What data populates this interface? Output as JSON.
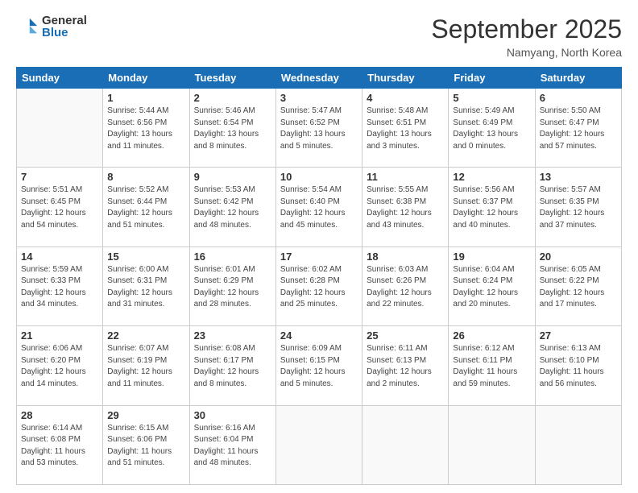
{
  "logo": {
    "general": "General",
    "blue": "Blue"
  },
  "header": {
    "month": "September 2025",
    "location": "Namyang, North Korea"
  },
  "days": [
    "Sunday",
    "Monday",
    "Tuesday",
    "Wednesday",
    "Thursday",
    "Friday",
    "Saturday"
  ],
  "weeks": [
    [
      {
        "day": "",
        "info": ""
      },
      {
        "day": "1",
        "info": "Sunrise: 5:44 AM\nSunset: 6:56 PM\nDaylight: 13 hours\nand 11 minutes."
      },
      {
        "day": "2",
        "info": "Sunrise: 5:46 AM\nSunset: 6:54 PM\nDaylight: 13 hours\nand 8 minutes."
      },
      {
        "day": "3",
        "info": "Sunrise: 5:47 AM\nSunset: 6:52 PM\nDaylight: 13 hours\nand 5 minutes."
      },
      {
        "day": "4",
        "info": "Sunrise: 5:48 AM\nSunset: 6:51 PM\nDaylight: 13 hours\nand 3 minutes."
      },
      {
        "day": "5",
        "info": "Sunrise: 5:49 AM\nSunset: 6:49 PM\nDaylight: 13 hours\nand 0 minutes."
      },
      {
        "day": "6",
        "info": "Sunrise: 5:50 AM\nSunset: 6:47 PM\nDaylight: 12 hours\nand 57 minutes."
      }
    ],
    [
      {
        "day": "7",
        "info": "Sunrise: 5:51 AM\nSunset: 6:45 PM\nDaylight: 12 hours\nand 54 minutes."
      },
      {
        "day": "8",
        "info": "Sunrise: 5:52 AM\nSunset: 6:44 PM\nDaylight: 12 hours\nand 51 minutes."
      },
      {
        "day": "9",
        "info": "Sunrise: 5:53 AM\nSunset: 6:42 PM\nDaylight: 12 hours\nand 48 minutes."
      },
      {
        "day": "10",
        "info": "Sunrise: 5:54 AM\nSunset: 6:40 PM\nDaylight: 12 hours\nand 45 minutes."
      },
      {
        "day": "11",
        "info": "Sunrise: 5:55 AM\nSunset: 6:38 PM\nDaylight: 12 hours\nand 43 minutes."
      },
      {
        "day": "12",
        "info": "Sunrise: 5:56 AM\nSunset: 6:37 PM\nDaylight: 12 hours\nand 40 minutes."
      },
      {
        "day": "13",
        "info": "Sunrise: 5:57 AM\nSunset: 6:35 PM\nDaylight: 12 hours\nand 37 minutes."
      }
    ],
    [
      {
        "day": "14",
        "info": "Sunrise: 5:59 AM\nSunset: 6:33 PM\nDaylight: 12 hours\nand 34 minutes."
      },
      {
        "day": "15",
        "info": "Sunrise: 6:00 AM\nSunset: 6:31 PM\nDaylight: 12 hours\nand 31 minutes."
      },
      {
        "day": "16",
        "info": "Sunrise: 6:01 AM\nSunset: 6:29 PM\nDaylight: 12 hours\nand 28 minutes."
      },
      {
        "day": "17",
        "info": "Sunrise: 6:02 AM\nSunset: 6:28 PM\nDaylight: 12 hours\nand 25 minutes."
      },
      {
        "day": "18",
        "info": "Sunrise: 6:03 AM\nSunset: 6:26 PM\nDaylight: 12 hours\nand 22 minutes."
      },
      {
        "day": "19",
        "info": "Sunrise: 6:04 AM\nSunset: 6:24 PM\nDaylight: 12 hours\nand 20 minutes."
      },
      {
        "day": "20",
        "info": "Sunrise: 6:05 AM\nSunset: 6:22 PM\nDaylight: 12 hours\nand 17 minutes."
      }
    ],
    [
      {
        "day": "21",
        "info": "Sunrise: 6:06 AM\nSunset: 6:20 PM\nDaylight: 12 hours\nand 14 minutes."
      },
      {
        "day": "22",
        "info": "Sunrise: 6:07 AM\nSunset: 6:19 PM\nDaylight: 12 hours\nand 11 minutes."
      },
      {
        "day": "23",
        "info": "Sunrise: 6:08 AM\nSunset: 6:17 PM\nDaylight: 12 hours\nand 8 minutes."
      },
      {
        "day": "24",
        "info": "Sunrise: 6:09 AM\nSunset: 6:15 PM\nDaylight: 12 hours\nand 5 minutes."
      },
      {
        "day": "25",
        "info": "Sunrise: 6:11 AM\nSunset: 6:13 PM\nDaylight: 12 hours\nand 2 minutes."
      },
      {
        "day": "26",
        "info": "Sunrise: 6:12 AM\nSunset: 6:11 PM\nDaylight: 11 hours\nand 59 minutes."
      },
      {
        "day": "27",
        "info": "Sunrise: 6:13 AM\nSunset: 6:10 PM\nDaylight: 11 hours\nand 56 minutes."
      }
    ],
    [
      {
        "day": "28",
        "info": "Sunrise: 6:14 AM\nSunset: 6:08 PM\nDaylight: 11 hours\nand 53 minutes."
      },
      {
        "day": "29",
        "info": "Sunrise: 6:15 AM\nSunset: 6:06 PM\nDaylight: 11 hours\nand 51 minutes."
      },
      {
        "day": "30",
        "info": "Sunrise: 6:16 AM\nSunset: 6:04 PM\nDaylight: 11 hours\nand 48 minutes."
      },
      {
        "day": "",
        "info": ""
      },
      {
        "day": "",
        "info": ""
      },
      {
        "day": "",
        "info": ""
      },
      {
        "day": "",
        "info": ""
      }
    ]
  ]
}
